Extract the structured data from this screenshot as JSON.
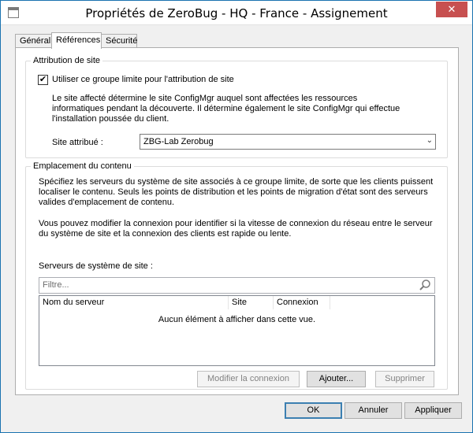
{
  "window": {
    "title": "Propriétés de ZeroBug - HQ - France - Assignement",
    "close_label": "✕"
  },
  "tabs": [
    {
      "label": "Général"
    },
    {
      "label": "Références"
    },
    {
      "label": "Sécurité"
    }
  ],
  "site_assignment": {
    "legend": "Attribution de site",
    "checkbox_label": "Utiliser ce groupe limite pour l'attribution de site",
    "checkbox_checked": true,
    "description": "Le site affecté détermine le site ConfigMgr auquel sont affectées les ressources informatiques pendant la découverte. Il détermine également le site ConfigMgr qui effectue l'installation poussée du client.",
    "site_label": "Site attribué :",
    "site_value": "ZBG-Lab Zerobug"
  },
  "content_location": {
    "legend": "Emplacement du contenu",
    "paragraph1": "Spécifiez les serveurs du système de site associés à ce groupe limite, de sorte que les clients puissent localiser le contenu. Seuls les points de distribution et les points de migration d'état sont des serveurs valides d'emplacement de contenu.",
    "paragraph2": "Vous pouvez modifier la connexion pour identifier si la vitesse de connexion du réseau entre le serveur du système de site et la connexion des clients est rapide ou lente.",
    "servers_label": "Serveurs de système de site :",
    "filter_placeholder": "Filtre...",
    "columns": [
      "Nom du serveur",
      "Site",
      "Connexion"
    ],
    "empty_message": "Aucun élément à afficher dans cette vue.",
    "buttons": {
      "modify": "Modifier la connexion",
      "add": "Ajouter...",
      "remove": "Supprimer"
    }
  },
  "footer": {
    "ok": "OK",
    "cancel": "Annuler",
    "apply": "Appliquer"
  }
}
